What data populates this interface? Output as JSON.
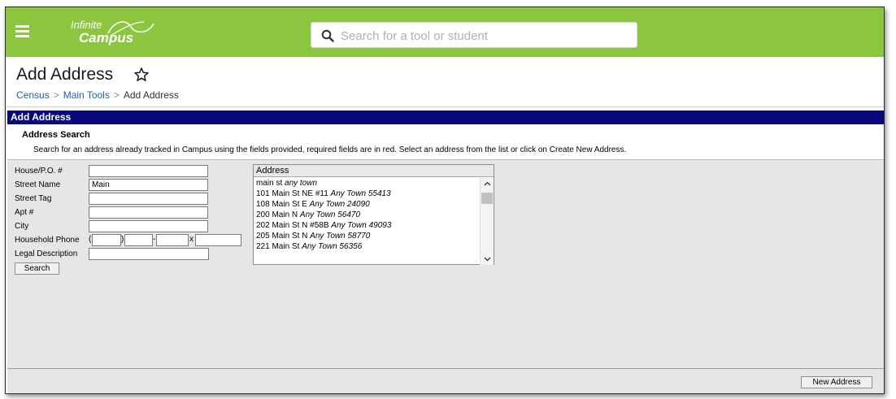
{
  "app": {
    "logo_line1": "Infinite",
    "logo_line2": "Campus",
    "brand_color": "#8cc63f"
  },
  "search": {
    "placeholder": "Search for a tool or student",
    "value": ""
  },
  "header": {
    "title": "Add Address",
    "breadcrumb": [
      "Census",
      "Main Tools",
      "Add Address"
    ],
    "separator": ">"
  },
  "section": {
    "bar_title": "Add Address",
    "subtitle": "Address Search",
    "instructions": "Search for an address already tracked in Campus using the fields provided, required fields are in red. Select an address from the list or click on Create New Address.",
    "bar_color": "#08087a"
  },
  "form": {
    "house_label": "House/P.O. #",
    "house_value": "",
    "street_name_label": "Street Name",
    "street_name_value": "Main",
    "street_tag_label": "Street Tag",
    "street_tag_value": "",
    "apt_label": "Apt #",
    "apt_value": "",
    "city_label": "City",
    "city_value": "",
    "phone_label": "Household Phone",
    "phone_open": "(",
    "phone_close": ")",
    "phone_dash": "-",
    "phone_ext": "x",
    "legal_label": "Legal Description",
    "legal_value": "",
    "search_button": "Search"
  },
  "results": {
    "header": "Address",
    "items": [
      {
        "street": "main st",
        "town": "any town"
      },
      {
        "street": "101 Main St NE #11",
        "town": "Any Town 55413"
      },
      {
        "street": "108 Main St E",
        "town": "Any Town 24090"
      },
      {
        "street": "200 Main N",
        "town": "Any Town 56470"
      },
      {
        "street": "202 Main St N #58B",
        "town": "Any Town 49093"
      },
      {
        "street": "205 Main St N",
        "town": "Any Town 58770"
      },
      {
        "street": "221 Main St",
        "town": "Any Town 56356"
      }
    ]
  },
  "footer": {
    "new_address_button": "New Address"
  },
  "icons": {
    "menu": "hamburger-menu-icon",
    "search": "search-icon",
    "favorite": "star-outline-icon",
    "scroll_up": "chevron-up-icon",
    "scroll_down": "chevron-down-icon"
  }
}
